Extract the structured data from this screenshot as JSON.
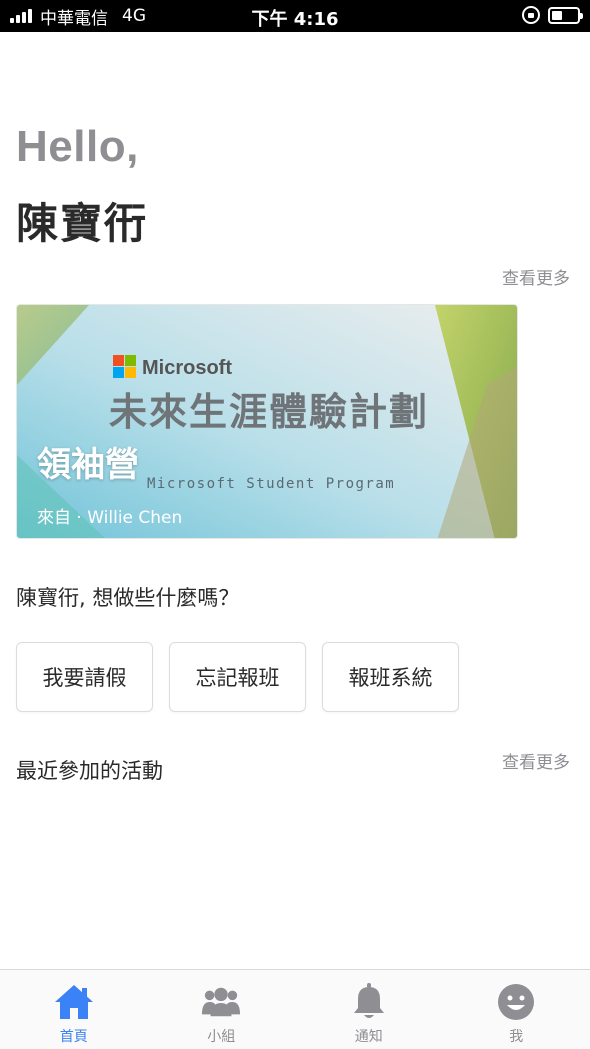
{
  "status_bar": {
    "carrier": "中華電信",
    "network": "4G",
    "time": "下午 4:16"
  },
  "greeting": {
    "hello": "Hello,",
    "name": "陳寶衎"
  },
  "featured": {
    "see_more": "查看更多",
    "card": {
      "title": "領袖營",
      "from": "來自 · Willie Chen",
      "image_brand": "Microsoft",
      "image_headline": "未來生涯體驗計劃",
      "image_subtitle": "Microsoft Student Program"
    }
  },
  "question": "陳寶衎, 想做些什麼嗎？",
  "actions": [
    {
      "label": "我要請假"
    },
    {
      "label": "忘記報班"
    },
    {
      "label": "報班系統"
    }
  ],
  "recent": {
    "title": "最近參加的活動",
    "see_more": "查看更多"
  },
  "tabs": [
    {
      "label": "首頁",
      "icon": "home-icon",
      "active": true
    },
    {
      "label": "小組",
      "icon": "group-icon",
      "active": false
    },
    {
      "label": "通知",
      "icon": "bell-icon",
      "active": false
    },
    {
      "label": "我",
      "icon": "smiley-icon",
      "active": false
    }
  ],
  "colors": {
    "accent": "#3b82f6",
    "inactive_icon": "#8e8e93",
    "hello_gray": "#8e8e93",
    "card_blue": "#8ecde0",
    "card_green": "#9fc05a"
  }
}
